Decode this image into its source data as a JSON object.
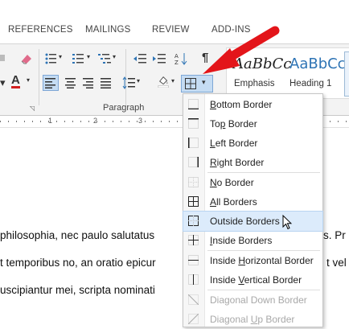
{
  "ribbon": {
    "tabs": [
      "REFERENCES",
      "MAILINGS",
      "REVIEW",
      "ADD-INS"
    ],
    "group_label": "Paragraph",
    "styles": [
      {
        "sample": "AaBbCc",
        "name": "Emphasis"
      },
      {
        "sample": "AaBbCc",
        "name": "Heading 1"
      }
    ]
  },
  "ruler": {
    "numbers": [
      "1",
      "2",
      "3"
    ]
  },
  "document": {
    "lines": [
      "philosophia, nec paulo salutatus",
      "t temporibus no, an oratio epicur",
      "uscipiantur mei, scripta nominati"
    ],
    "right_fragments": [
      "s. Pr",
      "t vel"
    ]
  },
  "border_menu": {
    "items": [
      {
        "label": "Bottom Border",
        "mnemonic": "B",
        "disabled": false
      },
      {
        "label": "Top Border",
        "mnemonic": "p",
        "disabled": false
      },
      {
        "label": "Left Border",
        "mnemonic": "L",
        "disabled": false
      },
      {
        "label": "Right Border",
        "mnemonic": "R",
        "disabled": false
      },
      {
        "label": "No Border",
        "mnemonic": "N",
        "disabled": false
      },
      {
        "label": "All Borders",
        "mnemonic": "A",
        "disabled": false
      },
      {
        "label": "Outside Borders",
        "mnemonic": "S",
        "disabled": false,
        "hovered": true
      },
      {
        "label": "Inside Borders",
        "mnemonic": "I",
        "disabled": false
      },
      {
        "label": "Inside Horizontal Border",
        "mnemonic": "H",
        "disabled": false
      },
      {
        "label": "Inside Vertical Border",
        "mnemonic": "V",
        "disabled": false
      },
      {
        "label": "Diagonal Down Border",
        "mnemonic": "W",
        "disabled": true
      },
      {
        "label": "Diagonal Up Border",
        "mnemonic": "U",
        "disabled": true
      }
    ]
  },
  "colors": {
    "accent": "#2e74b5",
    "hover": "#dcebfb",
    "arrow": "#e3151a"
  }
}
